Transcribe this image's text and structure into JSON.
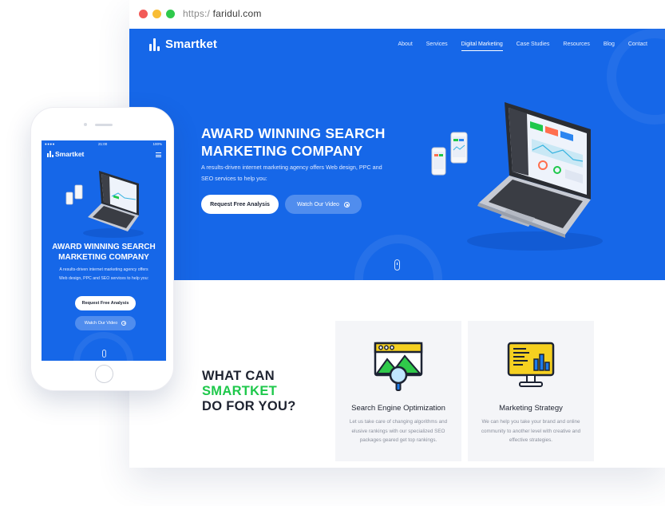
{
  "browser": {
    "url_protocol": "https:/",
    "url_domain": "faridul.com"
  },
  "site": {
    "brand": "Smartket",
    "nav": [
      "About",
      "Services",
      "Digital Marketing",
      "Case Studies",
      "Resources",
      "Blog",
      "Contact"
    ],
    "active_nav": "Digital Marketing",
    "hero": {
      "title_line1": "AWARD WINNING SEARCH",
      "title_line2": "MARKETING COMPANY",
      "subtitle": "A results-driven internet marketing agency offers Web design, PPC and SEO services to help you:",
      "primary_button": "Request Free Analysis",
      "secondary_button": "Watch Our Video"
    },
    "section": {
      "line1": "WHAT CAN",
      "line2": "SMARTKET",
      "line3": "DO FOR YOU?"
    },
    "cards": [
      {
        "title": "Search Engine Optimization",
        "text": "Let us take care of changing algorithms and elusive rankings with our specialized SEO packages geared get top rankings.",
        "icon": "seo-browser-magnifier-icon"
      },
      {
        "title": "Marketing Strategy",
        "text": "We can help you take your brand and online community to another level with creative and effective strategies.",
        "icon": "monitor-chart-icon"
      }
    ]
  },
  "mobile": {
    "time": "21:00",
    "battery": "100%",
    "title_line1": "AWARD WINNING SEARCH",
    "title_line2": "MARKETING COMPANY",
    "subtitle": "A results-driven internet marketing agency offers Web design, PPC and SEO services to help you:",
    "primary_button": "Request Free Analysis",
    "secondary_button": "Watch Our Video"
  },
  "colors": {
    "brand_blue": "#1667e8",
    "accent_green": "#1ec84b",
    "dark_text": "#1e2330",
    "card_bg": "#f4f5f8"
  }
}
